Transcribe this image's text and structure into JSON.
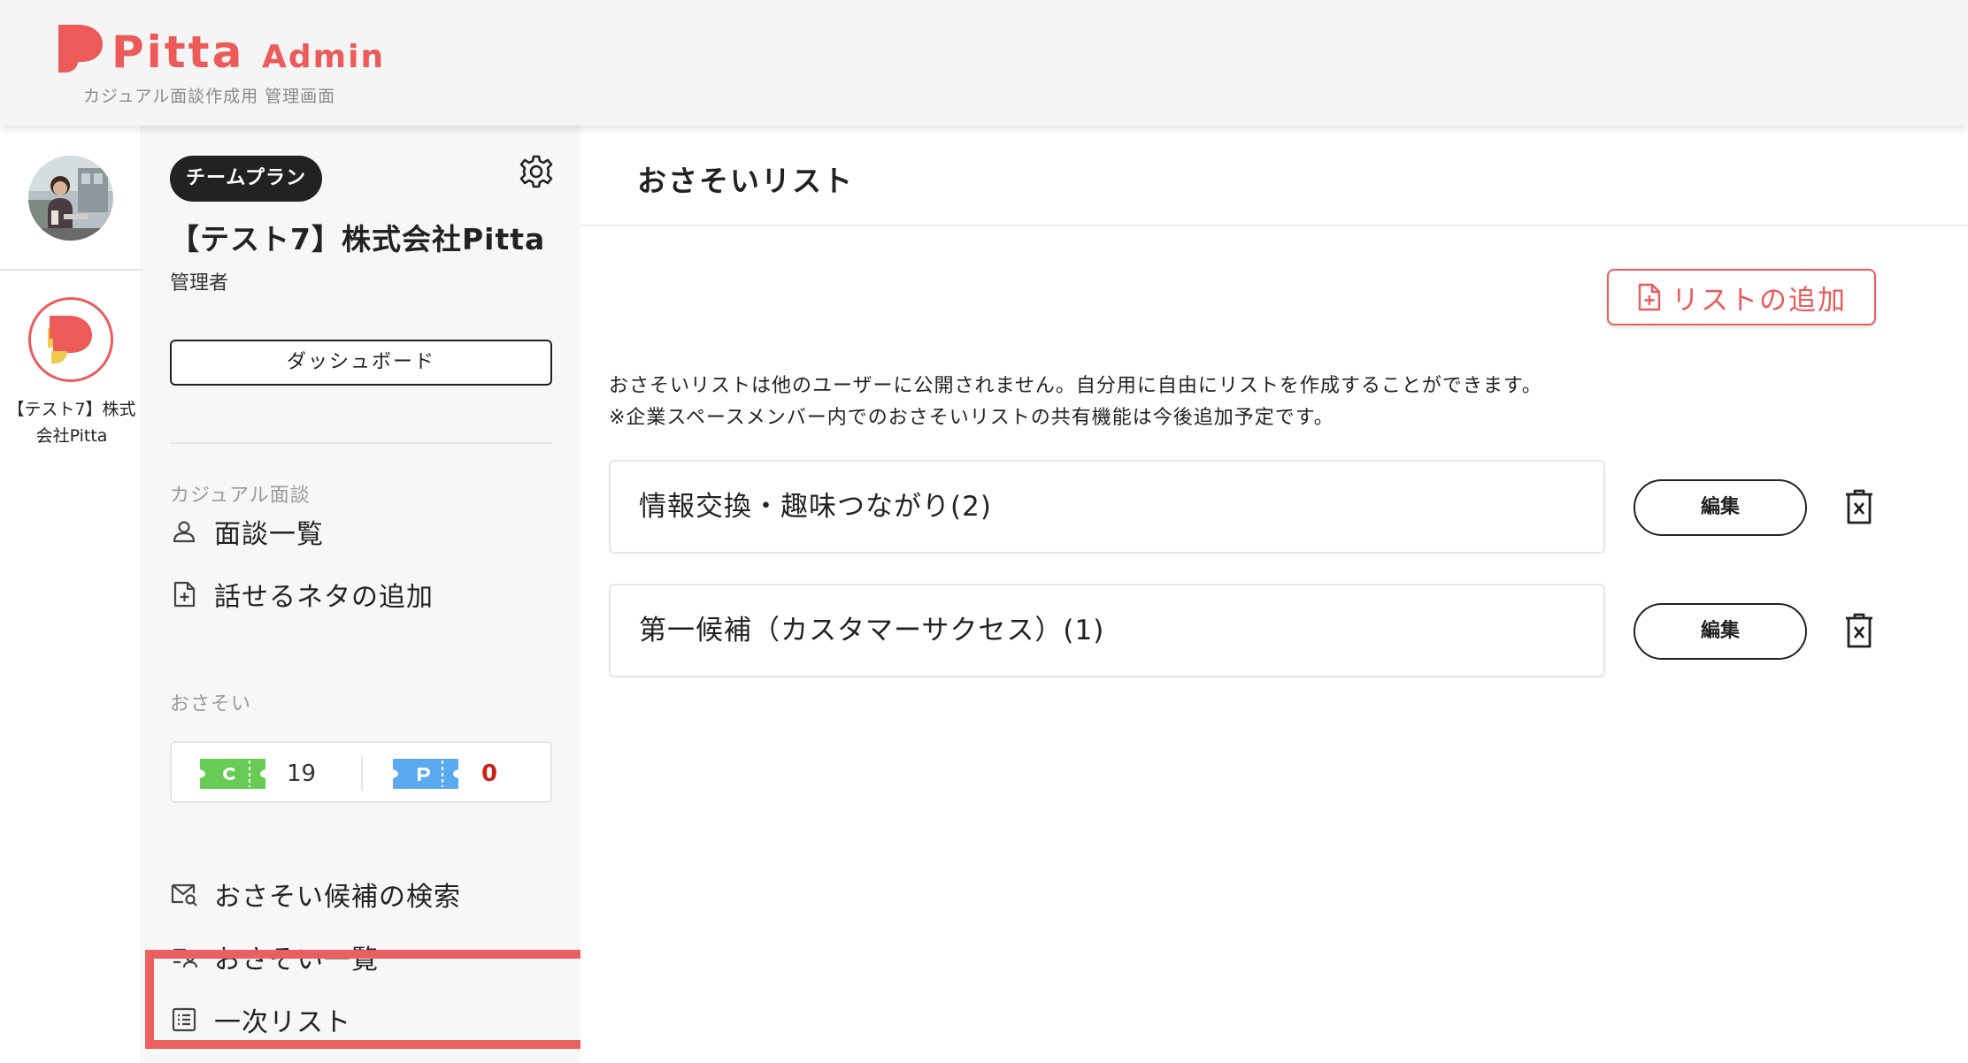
{
  "header": {
    "logo_text": "Pitta",
    "logo_admin": "Admin",
    "subtitle": "カジュアル面談作成用 管理画面",
    "brand_color": "#ec5a5a"
  },
  "rail": {
    "company_name": "【テスト7】株式会社Pitta"
  },
  "sidebar": {
    "plan_badge": "チームプラン",
    "company_title": "【テスト7】株式会社Pitta",
    "role": "管理者",
    "dashboard_label": "ダッシュボード",
    "section_casual": "カジュアル面談",
    "casual_items": [
      {
        "label": "面談一覧",
        "icon": "person-icon"
      },
      {
        "label": "話せるネタの追加",
        "icon": "file-add-icon"
      }
    ],
    "section_osasoi": "おさそい",
    "tickets": {
      "c_label": "C",
      "c_count": "19",
      "p_label": "P",
      "p_count": "0",
      "c_color": "#66cc55",
      "p_color": "#5aaaf0",
      "p_count_color": "#c8221a"
    },
    "osasoi_items": [
      {
        "label": "おさそい候補の検索",
        "icon": "mail-search-icon"
      },
      {
        "label": "おさそい一覧",
        "icon": "list-person-icon"
      },
      {
        "label": "一次リスト",
        "icon": "list-icon"
      }
    ],
    "highlight_color": "#ea5f5f"
  },
  "main": {
    "title": "おさそいリスト",
    "add_list_label": "リストの追加",
    "description_line1": "おさそいリストは他のユーザーに公開されません。自分用に自由にリストを作成することができます。",
    "description_line2": "※企業スペースメンバー内でのおさそいリストの共有機能は今後追加予定です。",
    "lists": [
      {
        "name": "情報交換・趣味つながり(2)",
        "edit_label": "編集"
      },
      {
        "name": "第一候補（カスタマーサクセス）(1)",
        "edit_label": "編集"
      }
    ]
  }
}
